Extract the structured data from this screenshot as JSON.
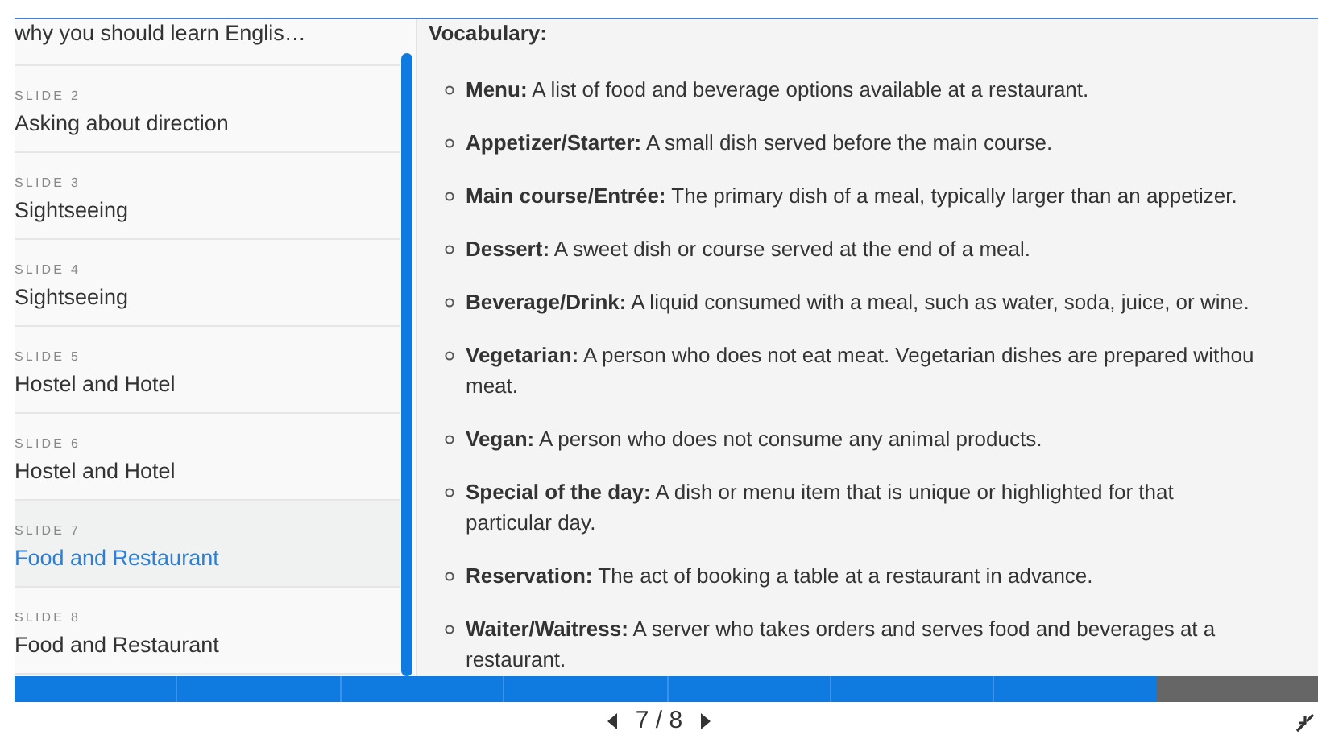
{
  "sidebar": {
    "items": [
      {
        "title": "why you should learn Englis…",
        "selected": false
      },
      {
        "label": "SLIDE 2",
        "title": "Asking about direction",
        "selected": false
      },
      {
        "label": "SLIDE 3",
        "title": "Sightseeing",
        "selected": false
      },
      {
        "label": "SLIDE 4",
        "title": "Sightseeing",
        "selected": false
      },
      {
        "label": "SLIDE 5",
        "title": "Hostel and Hotel",
        "selected": false
      },
      {
        "label": "SLIDE 6",
        "title": "Hostel and Hotel",
        "selected": false
      },
      {
        "label": "SLIDE 7",
        "title": "Food and Restaurant",
        "selected": true
      },
      {
        "label": "SLIDE 8",
        "title": "Food and Restaurant",
        "selected": false
      }
    ]
  },
  "content": {
    "heading": "Vocabulary:",
    "items": [
      {
        "lines": [
          "**Menu:** A list of food and beverage options available at a restaurant."
        ]
      },
      {
        "lines": [
          "**Appetizer/Starter:** A small dish served before the main course."
        ]
      },
      {
        "lines": [
          "**Main course/Entrée:** The primary dish of a meal, typically larger than an appetizer."
        ]
      },
      {
        "lines": [
          "**Dessert:** A sweet dish or course served at the end of a meal."
        ]
      },
      {
        "lines": [
          "**Beverage/Drink:** A liquid consumed with a meal, such as water, soda, juice, or wine."
        ]
      },
      {
        "lines": [
          "**Vegetarian:** A person who does not eat meat. Vegetarian dishes are prepared withou",
          "meat."
        ]
      },
      {
        "lines": [
          "**Vegan:** A person who does not consume any animal products."
        ]
      },
      {
        "lines": [
          "**Special of the day:** A dish or menu item that is unique or highlighted for that",
          "particular day."
        ]
      },
      {
        "lines": [
          "**Reservation:** The act of booking a table at a restaurant in advance."
        ]
      },
      {
        "lines": [
          "**Waiter/Waitress:** A server who takes orders and serves food and beverages at a",
          "restaurant."
        ]
      }
    ]
  },
  "progress": {
    "segments": [
      {
        "filled": true
      },
      {
        "filled": true
      },
      {
        "filled": true
      },
      {
        "filled": true
      },
      {
        "filled": true
      },
      {
        "filled": true
      },
      {
        "filled": true
      },
      {
        "filled": false
      }
    ]
  },
  "nav": {
    "counter": "7 / 8"
  }
}
